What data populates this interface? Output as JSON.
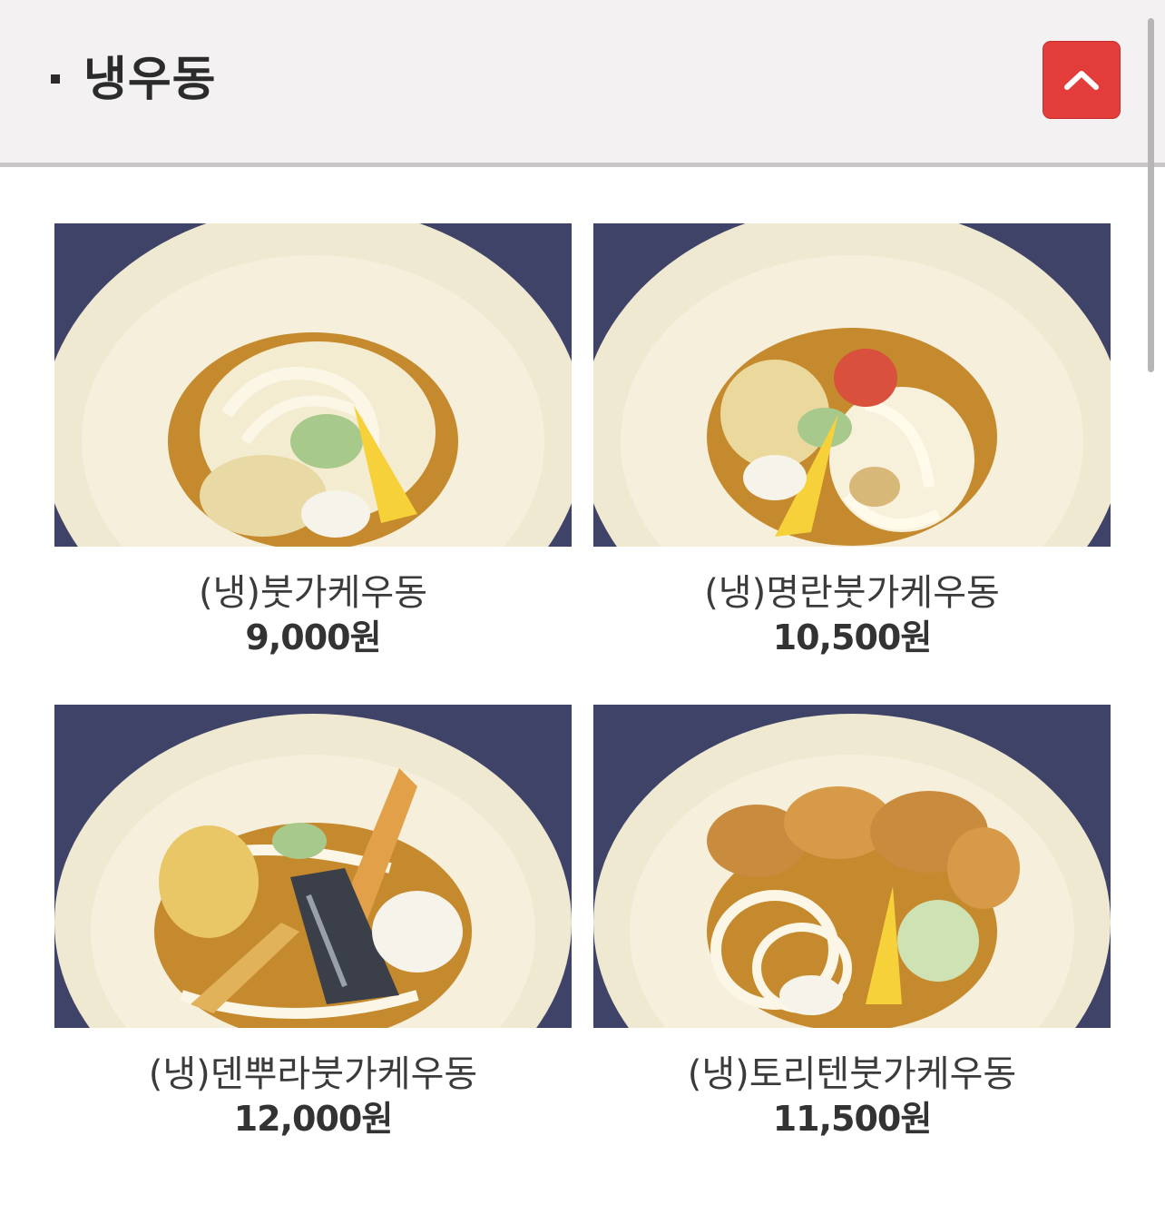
{
  "section": {
    "title": "냉우동"
  },
  "scroll_top_icon": "chevron-up-icon",
  "colors": {
    "header_bg": "#f3f1f2",
    "accent": "#e33d3b",
    "tablecloth": "#3f4368",
    "bowl": "#f2ebd3"
  },
  "menu_items": [
    {
      "name": "(냉)붓가케우동",
      "price": "9,000원",
      "photo": "bukkake-udon-photo"
    },
    {
      "name": "(냉)명란붓가케우동",
      "price": "10,500원",
      "photo": "mentaiko-bukkake-udon-photo"
    },
    {
      "name": "(냉)덴뿌라붓가케우동",
      "price": "12,000원",
      "photo": "tempura-bukkake-udon-photo"
    },
    {
      "name": "(냉)토리텐붓가케우동",
      "price": "11,500원",
      "photo": "toriten-bukkake-udon-photo"
    }
  ]
}
